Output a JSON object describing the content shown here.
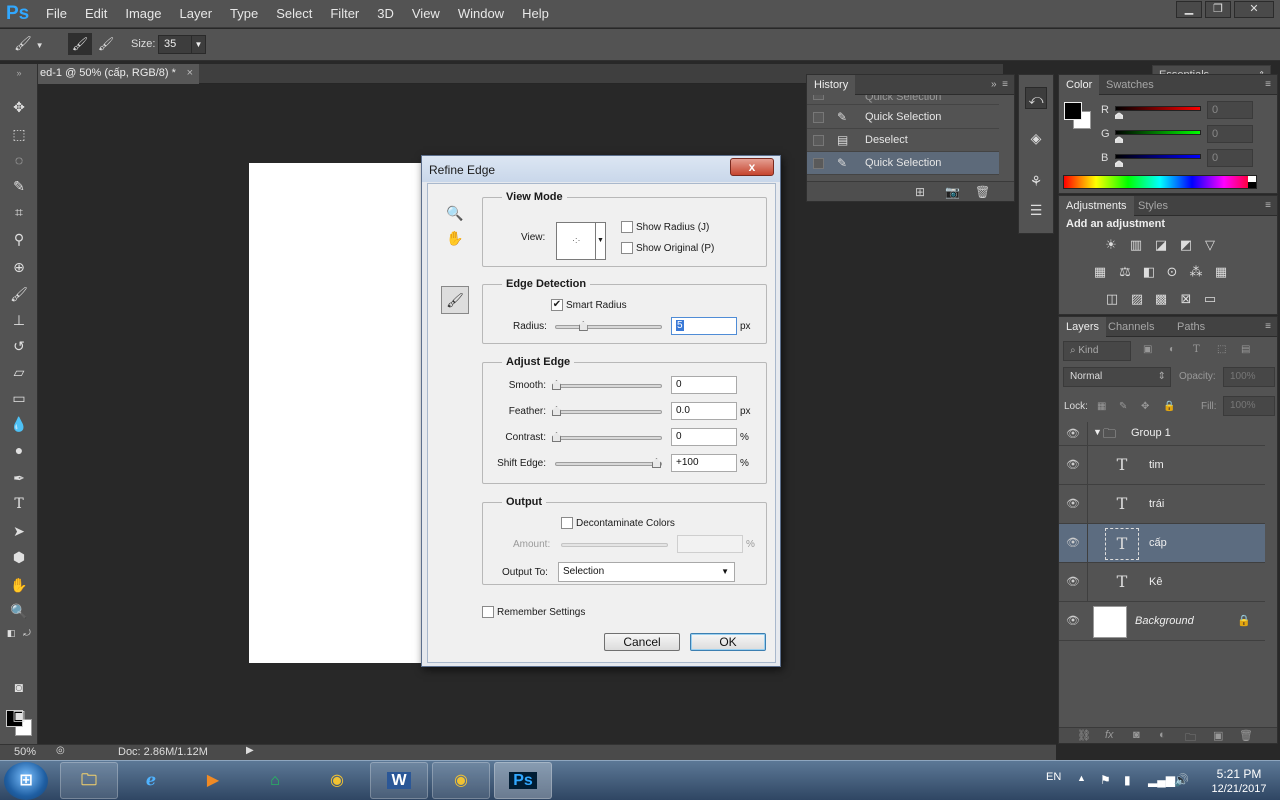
{
  "app": {
    "logo": "Ps"
  },
  "menu": [
    "File",
    "Edit",
    "Image",
    "Layer",
    "Type",
    "Select",
    "Filter",
    "3D",
    "View",
    "Window",
    "Help"
  ],
  "window_controls": {
    "minimize": "▁",
    "restore": "❐",
    "close": "✕"
  },
  "options_bar": {
    "size_label": "Size:",
    "size_value": "35",
    "workspace": "Essentials"
  },
  "document": {
    "tab_title": "ed-1 @ 50% (cấp, RGB/8) *",
    "close": "×"
  },
  "status": {
    "zoom": "50%",
    "doc_info": "Doc: 2.86M/1.12M"
  },
  "history": {
    "tab": "History",
    "items": [
      {
        "label": "Quick Selection",
        "selected": false
      },
      {
        "label": "Deselect",
        "selected": false
      },
      {
        "label": "Quick Selection",
        "selected": true
      }
    ]
  },
  "color_panel": {
    "tabs": [
      "Color",
      "Swatches"
    ],
    "channels": [
      {
        "name": "R",
        "value": "0",
        "color": "#ff0000"
      },
      {
        "name": "G",
        "value": "0",
        "color": "#00ff00"
      },
      {
        "name": "B",
        "value": "0",
        "color": "#0000ff"
      }
    ]
  },
  "adjustments": {
    "tabs": [
      "Adjustments",
      "Styles"
    ],
    "title": "Add an adjustment"
  },
  "layers_panel": {
    "tabs": [
      "Layers",
      "Channels",
      "Paths"
    ],
    "kind": "Kind",
    "blend_mode": "Normal",
    "opacity_label": "Opacity:",
    "opacity": "100%",
    "lock_label": "Lock:",
    "fill_label": "Fill:",
    "fill": "100%",
    "group": "Group 1",
    "layers": [
      {
        "name": "tim",
        "type": "text",
        "selected": false
      },
      {
        "name": "trái",
        "type": "text",
        "selected": false
      },
      {
        "name": "cấp",
        "type": "text",
        "selected": true
      },
      {
        "name": "Kê",
        "type": "text",
        "selected": false
      },
      {
        "name": "Background",
        "type": "background",
        "selected": false
      }
    ]
  },
  "dialog": {
    "title": "Refine Edge",
    "close": "x",
    "view_mode": {
      "legend": "View Mode",
      "view_label": "View:",
      "show_radius": "Show Radius (J)",
      "show_original": "Show Original (P)"
    },
    "edge_detection": {
      "legend": "Edge Detection",
      "smart_radius": "Smart Radius",
      "smart_radius_checked": true,
      "radius_label": "Radius:",
      "radius_value": "5",
      "radius_unit": "px",
      "radius_fraction": 0.25
    },
    "adjust_edge": {
      "legend": "Adjust Edge",
      "fields": [
        {
          "label": "Smooth:",
          "value": "0",
          "unit": "",
          "fraction": 0
        },
        {
          "label": "Feather:",
          "value": "0.0",
          "unit": "px",
          "fraction": 0
        },
        {
          "label": "Contrast:",
          "value": "0",
          "unit": "%",
          "fraction": 0
        },
        {
          "label": "Shift Edge:",
          "value": "+100",
          "unit": "%",
          "fraction": 1
        }
      ]
    },
    "output": {
      "legend": "Output",
      "decontaminate": "Decontaminate Colors",
      "amount_label": "Amount:",
      "amount_unit": "%",
      "output_to_label": "Output To:",
      "output_to_value": "Selection"
    },
    "remember": "Remember Settings",
    "cancel": "Cancel",
    "ok": "OK"
  },
  "taskbar": {
    "lang": "EN",
    "time": "5:21 PM",
    "date": "12/21/2017",
    "word_icon": "W",
    "ps_icon": "Ps"
  }
}
